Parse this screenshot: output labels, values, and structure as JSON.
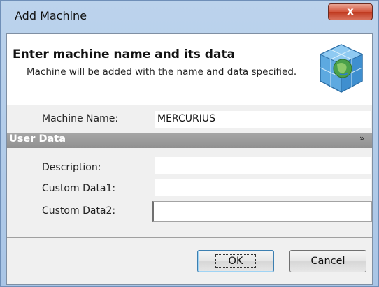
{
  "window": {
    "title": "Add Machine",
    "close_label": "x"
  },
  "header": {
    "title": "Enter machine name and its data",
    "description": "Machine will be added with the name and data specified.",
    "icon": "globe-cube-icon"
  },
  "form": {
    "machine_name_label": "Machine Name:",
    "machine_name_value": "MERCURIUS",
    "section_title": "User Data",
    "section_toggle": "»",
    "description_label": "Description:",
    "description_value": "",
    "custom1_label": "Custom Data1:",
    "custom1_value": "",
    "custom2_label": "Custom Data2:",
    "custom2_value": ""
  },
  "buttons": {
    "ok_label": "OK",
    "cancel_label": "Cancel"
  }
}
